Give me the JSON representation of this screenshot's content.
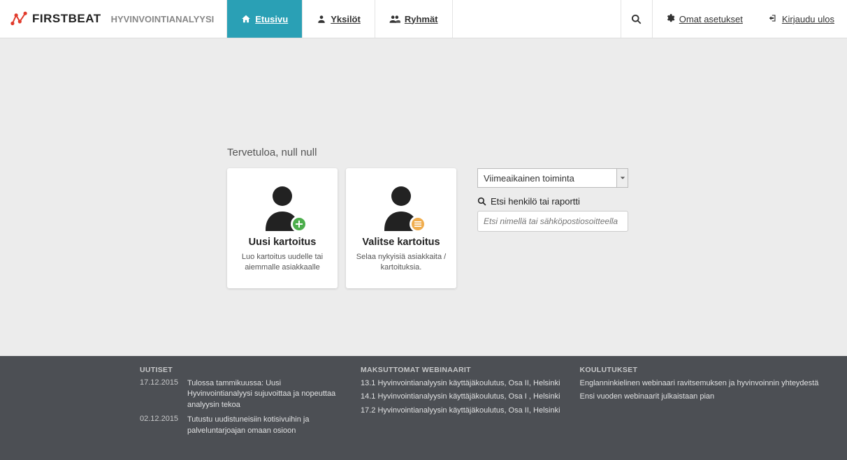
{
  "brand": {
    "name": "FIRSTBEAT",
    "sub": "HYVINVOINTIANALYYSI"
  },
  "nav": {
    "home": "Etusivu",
    "individuals": "Yksilöt",
    "groups": "Ryhmät",
    "settings": "Omat asetukset",
    "logout": "Kirjaudu ulos"
  },
  "main": {
    "welcome": "Tervetuloa, null null",
    "card_new_title": "Uusi kartoitus",
    "card_new_sub": "Luo kartoitus uudelle tai aiemmalle asiakkaalle",
    "card_select_title": "Valitse kartoitus",
    "card_select_sub": "Selaa nykyisiä asiakkaita / kartoituksia.",
    "recent_activity_label": "Viimeaikainen toiminta",
    "search_label": "Etsi henkilö tai raportti",
    "search_placeholder": "Etsi nimellä tai sähköpostiosoitteella"
  },
  "footer": {
    "news_heading": "UUTISET",
    "news": [
      {
        "date": "17.12.2015",
        "text": "Tulossa tammikuussa: Uusi Hyvinvointianalyysi sujuvoittaa ja nopeuttaa analyysin tekoa"
      },
      {
        "date": "02.12.2015",
        "text": "Tutustu uudistuneisiin kotisivuihin ja palveluntarjoajan omaan osioon"
      }
    ],
    "webinars_heading": "MAKSUTTOMAT WEBINAARIT",
    "webinars": [
      "13.1 Hyvinvointianalyysin käyttäjäkoulutus, Osa II, Helsinki",
      "14.1 Hyvinvointianalyysin käyttäjäkoulutus, Osa I , Helsinki",
      "17.2 Hyvinvointianalyysin käyttäjäkoulutus, Osa II, Helsinki"
    ],
    "trainings_heading": "KOULUTUKSET",
    "trainings": [
      "Englanninkielinen webinaari ravitsemuksen ja hyvinvoinnin yhteydestä",
      "Ensi vuoden webinaarit julkaistaan pian"
    ]
  }
}
